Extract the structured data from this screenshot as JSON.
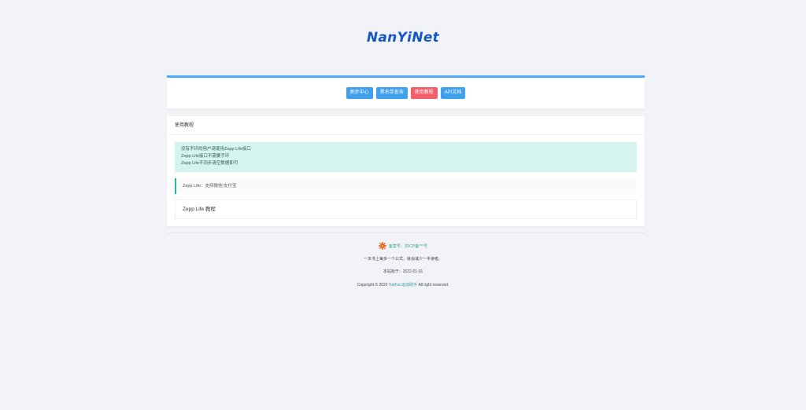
{
  "header": {
    "logo_text": "NanYiNet"
  },
  "nav": {
    "buttons": [
      {
        "label": "刷步中心",
        "color": "#3fa0ee"
      },
      {
        "label": "黑名单查询",
        "color": "#3fa0ee"
      },
      {
        "label": "使用教程",
        "color": "#f1606a"
      },
      {
        "label": "API文档",
        "color": "#3fa0ee"
      }
    ]
  },
  "main": {
    "title": "使用教程",
    "notice_lines": [
      "没有手环的用户请使用Zepp Life接口",
      "Zepp Life接口不需要手环",
      "Zepp Life不同步清空数据即可"
    ],
    "quote_text": "Zepp Life：支持微信/支付宝",
    "collapse_title": "Zepp Life 教程"
  },
  "footer": {
    "icon": "gear-icon",
    "icp_text": "备案号：苏ICP备***号",
    "motto": "一本书上每多一个公式，就会减少一半读者。",
    "since_text": "本站始于：2022-01-01",
    "copyright_prefix": "Copyright © 2022",
    "copyright_link": "Nathan运动助手",
    "copyright_suffix": "All right reserved."
  }
}
